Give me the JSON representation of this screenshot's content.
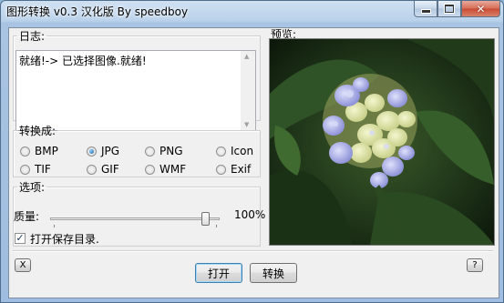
{
  "window": {
    "title": "图形转换 v0.3 汉化版 By speedboy",
    "min_glyph": "",
    "close_glyph": "✕"
  },
  "log": {
    "legend": "日志:",
    "text": "就绪!-> 已选择图像.就绪!"
  },
  "preview": {
    "legend": "预览:"
  },
  "convert": {
    "legend": "转换成:",
    "formats": [
      {
        "label": "BMP",
        "selected": false
      },
      {
        "label": "JPG",
        "selected": true
      },
      {
        "label": "PNG",
        "selected": false
      },
      {
        "label": "Icon",
        "selected": false
      },
      {
        "label": "TIF",
        "selected": false
      },
      {
        "label": "GIF",
        "selected": false
      },
      {
        "label": "WMF",
        "selected": false
      },
      {
        "label": "Exif",
        "selected": false
      }
    ]
  },
  "options": {
    "legend": "选项:",
    "quality_label": "质量:",
    "quality_value": "100%",
    "quality_level": 1.0,
    "open_dir_label": "打开保存目录.",
    "open_dir_checked": true
  },
  "bottom": {
    "close_small": "X",
    "open_button": "打开",
    "convert_button": "转换",
    "help_button": "?"
  },
  "colors": {
    "title_bar": "#b9d1ea",
    "close_button": "#c84a32",
    "accent": "#3c7fb1"
  }
}
